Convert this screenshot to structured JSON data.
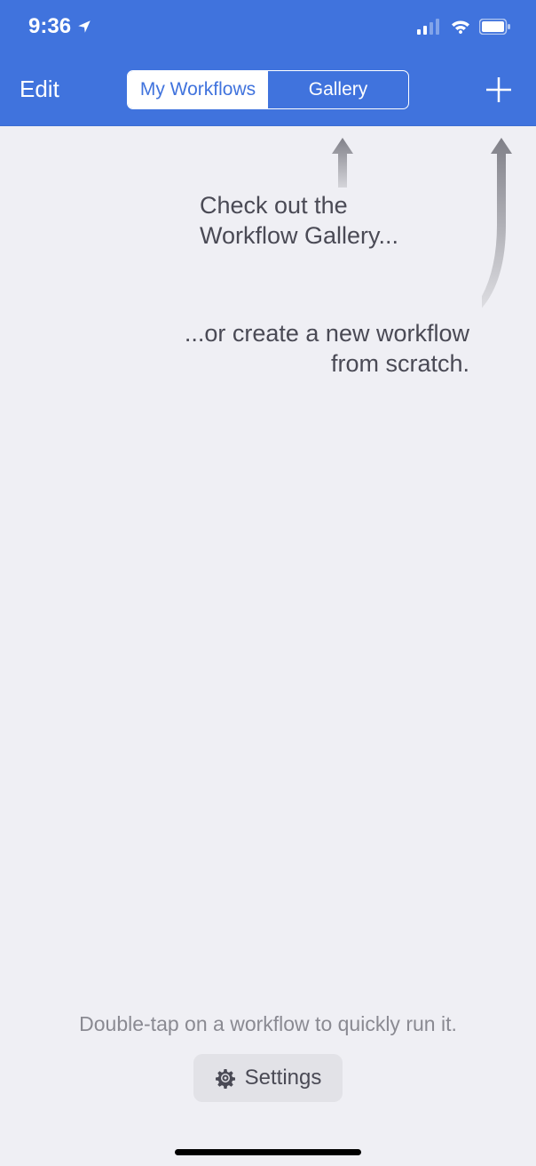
{
  "status_bar": {
    "time": "9:36"
  },
  "nav_bar": {
    "edit_label": "Edit",
    "segments": {
      "my_workflows": "My Workflows",
      "gallery": "Gallery"
    }
  },
  "hints": {
    "gallery_line1": "Check out the",
    "gallery_line2": "Workflow Gallery...",
    "create_line1": "...or create a new workflow",
    "create_line2": "from scratch."
  },
  "bottom": {
    "tip": "Double-tap on a workflow to quickly run it.",
    "settings_label": "Settings"
  },
  "colors": {
    "primary": "#4073dd",
    "background": "#efeff4",
    "hint_text": "#4a4a55",
    "tip_text": "#8a8a92"
  }
}
